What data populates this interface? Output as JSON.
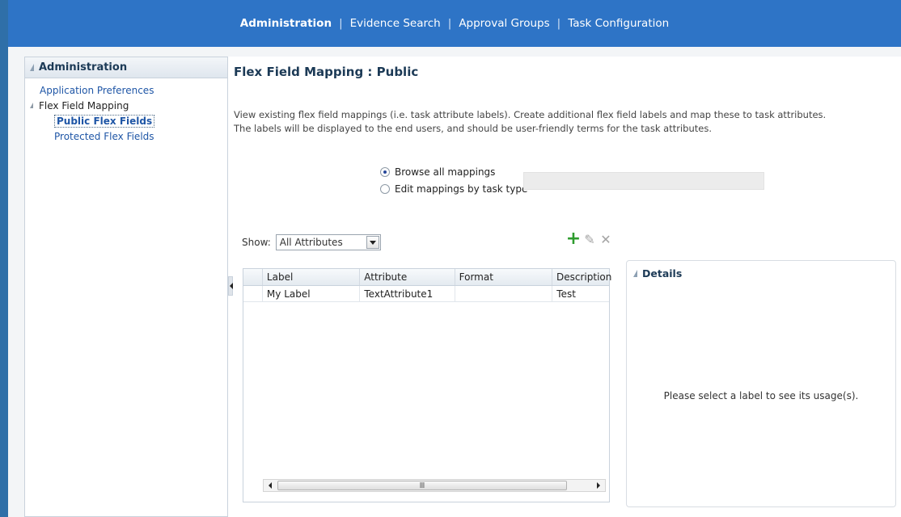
{
  "top_nav": {
    "items": [
      "Administration",
      "Evidence Search",
      "Approval Groups",
      "Task Configuration"
    ],
    "active": "Administration"
  },
  "sidebar": {
    "header": "Administration",
    "items": [
      {
        "label": "Application Preferences"
      },
      {
        "label": "Flex Field Mapping"
      },
      {
        "label": "Public Flex Fields"
      },
      {
        "label": "Protected Flex Fields"
      }
    ]
  },
  "main": {
    "title": "Flex Field Mapping : Public",
    "description_line1": "View existing flex field mappings (i.e. task attribute labels). Create additional flex field labels and map these to task attributes.",
    "description_line2": "The labels will be displayed to the end users, and should be user-friendly terms for the task attributes.",
    "radio_browse": "Browse all mappings",
    "radio_edit": "Edit mappings by task type",
    "show_label": "Show:",
    "show_value": "All Attributes"
  },
  "table": {
    "columns": [
      "Label",
      "Attribute",
      "Format",
      "Description"
    ],
    "rows": [
      {
        "label": "My Label",
        "attribute": "TextAttribute1",
        "format": "",
        "description": "Test"
      }
    ]
  },
  "details": {
    "header": "Details",
    "empty_message": "Please select a label to see its usage(s)."
  },
  "colors": {
    "topnav_bg": "#2e74c6",
    "link": "#1f56a6",
    "add_icon": "#2e9c2e"
  }
}
